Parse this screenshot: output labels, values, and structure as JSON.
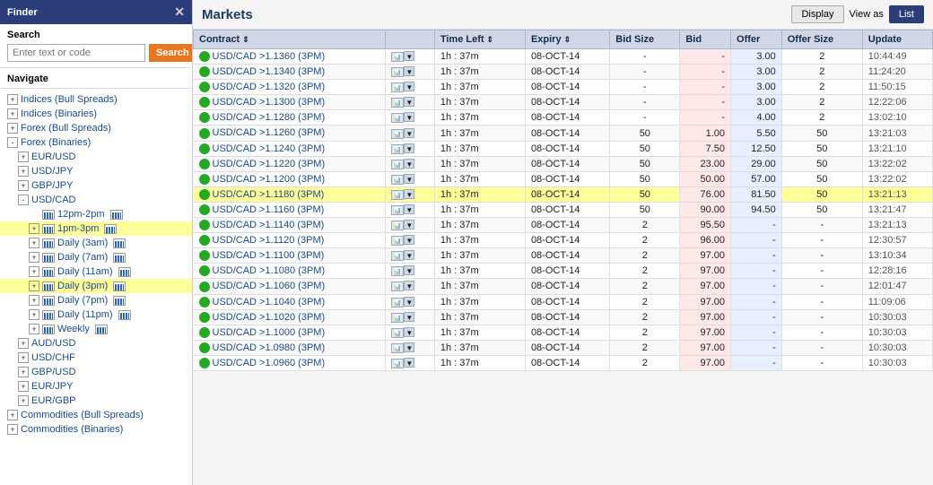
{
  "sidebar": {
    "title": "Finder",
    "close_label": "✕",
    "search": {
      "label": "Search",
      "placeholder": "Enter text or code",
      "button_label": "Search"
    },
    "navigate_label": "Navigate",
    "nav_items": [
      {
        "id": "indices-bull",
        "label": "Indices (Bull Spreads)",
        "indent": 0,
        "expander": "+",
        "highlighted": false
      },
      {
        "id": "indices-bin",
        "label": "Indices (Binaries)",
        "indent": 0,
        "expander": "+",
        "highlighted": false
      },
      {
        "id": "forex-bull",
        "label": "Forex (Bull Spreads)",
        "indent": 0,
        "expander": "+",
        "highlighted": false
      },
      {
        "id": "forex-bin",
        "label": "Forex (Binaries)",
        "indent": 0,
        "expander": "-",
        "highlighted": false
      },
      {
        "id": "eur-usd",
        "label": "EUR/USD",
        "indent": 1,
        "expander": "+",
        "highlighted": false
      },
      {
        "id": "usd-jpy",
        "label": "USD/JPY",
        "indent": 1,
        "expander": "+",
        "highlighted": false
      },
      {
        "id": "gbp-jpy",
        "label": "GBP/JPY",
        "indent": 1,
        "expander": "+",
        "highlighted": false
      },
      {
        "id": "usd-cad",
        "label": "USD/CAD",
        "indent": 1,
        "expander": "-",
        "highlighted": false
      },
      {
        "id": "12pm-2pm",
        "label": "12pm-2pm",
        "indent": 2,
        "expander": null,
        "highlighted": false,
        "has_chart": true
      },
      {
        "id": "1pm-3pm",
        "label": "1pm-3pm",
        "indent": 2,
        "expander": "+",
        "highlighted": true,
        "has_chart": true
      },
      {
        "id": "daily-3am",
        "label": "Daily (3am)",
        "indent": 2,
        "expander": "+",
        "highlighted": false,
        "has_chart": true
      },
      {
        "id": "daily-7am",
        "label": "Daily (7am)",
        "indent": 2,
        "expander": "+",
        "highlighted": false,
        "has_chart": true
      },
      {
        "id": "daily-11am",
        "label": "Daily (11am)",
        "indent": 2,
        "expander": "+",
        "highlighted": false,
        "has_chart": true
      },
      {
        "id": "daily-3pm",
        "label": "Daily (3pm)",
        "indent": 2,
        "expander": "+",
        "highlighted": true,
        "has_chart": true
      },
      {
        "id": "daily-7pm",
        "label": "Daily (7pm)",
        "indent": 2,
        "expander": "+",
        "highlighted": false,
        "has_chart": true
      },
      {
        "id": "daily-11pm",
        "label": "Daily (11pm)",
        "indent": 2,
        "expander": "+",
        "highlighted": false,
        "has_chart": true
      },
      {
        "id": "weekly",
        "label": "Weekly",
        "indent": 2,
        "expander": "+",
        "highlighted": false,
        "has_chart": true
      },
      {
        "id": "aud-usd",
        "label": "AUD/USD",
        "indent": 1,
        "expander": "+",
        "highlighted": false
      },
      {
        "id": "usd-chf",
        "label": "USD/CHF",
        "indent": 1,
        "expander": "+",
        "highlighted": false
      },
      {
        "id": "gbp-usd",
        "label": "GBP/USD",
        "indent": 1,
        "expander": "+",
        "highlighted": false
      },
      {
        "id": "eur-jpy",
        "label": "EUR/JPY",
        "indent": 1,
        "expander": "+",
        "highlighted": false
      },
      {
        "id": "eur-gbp",
        "label": "EUR/GBP",
        "indent": 1,
        "expander": "+",
        "highlighted": false
      },
      {
        "id": "commodities-bull",
        "label": "Commodities (Bull Spreads)",
        "indent": 0,
        "expander": "+",
        "highlighted": false
      },
      {
        "id": "commodities-bin",
        "label": "Commodities (Binaries)",
        "indent": 0,
        "expander": "+",
        "highlighted": false
      }
    ]
  },
  "main": {
    "title": "Markets",
    "display_label": "Display",
    "view_as_label": "View as",
    "list_label": "List",
    "columns": [
      {
        "id": "contract",
        "label": "Contract",
        "sortable": true
      },
      {
        "id": "icons",
        "label": "",
        "sortable": false
      },
      {
        "id": "timeleft",
        "label": "Time Left",
        "sortable": true
      },
      {
        "id": "expiry",
        "label": "Expiry",
        "sortable": true
      },
      {
        "id": "bidsize",
        "label": "Bid Size",
        "sortable": false
      },
      {
        "id": "bid",
        "label": "Bid",
        "sortable": false
      },
      {
        "id": "offer",
        "label": "Offer",
        "sortable": false
      },
      {
        "id": "offersize",
        "label": "Offer Size",
        "sortable": false
      },
      {
        "id": "update",
        "label": "Update",
        "sortable": false
      }
    ],
    "rows": [
      {
        "contract": "USD/CAD >1.1360 (3PM)",
        "timeleft": "1h : 37m",
        "expiry": "08-OCT-14",
        "bidsize": "-",
        "bid": "-",
        "offer": "3.00",
        "offersize": "2",
        "update": "10:44:49",
        "highlighted": false
      },
      {
        "contract": "USD/CAD >1.1340 (3PM)",
        "timeleft": "1h : 37m",
        "expiry": "08-OCT-14",
        "bidsize": "-",
        "bid": "-",
        "offer": "3.00",
        "offersize": "2",
        "update": "11:24:20",
        "highlighted": false
      },
      {
        "contract": "USD/CAD >1.1320 (3PM)",
        "timeleft": "1h : 37m",
        "expiry": "08-OCT-14",
        "bidsize": "-",
        "bid": "-",
        "offer": "3.00",
        "offersize": "2",
        "update": "11:50:15",
        "highlighted": false
      },
      {
        "contract": "USD/CAD >1.1300 (3PM)",
        "timeleft": "1h : 37m",
        "expiry": "08-OCT-14",
        "bidsize": "-",
        "bid": "-",
        "offer": "3.00",
        "offersize": "2",
        "update": "12:22:06",
        "highlighted": false
      },
      {
        "contract": "USD/CAD >1.1280 (3PM)",
        "timeleft": "1h : 37m",
        "expiry": "08-OCT-14",
        "bidsize": "-",
        "bid": "-",
        "offer": "4.00",
        "offersize": "2",
        "update": "13:02:10",
        "highlighted": false
      },
      {
        "contract": "USD/CAD >1.1260 (3PM)",
        "timeleft": "1h : 37m",
        "expiry": "08-OCT-14",
        "bidsize": "50",
        "bid": "1.00",
        "offer": "5.50",
        "offersize": "50",
        "update": "13:21:03",
        "highlighted": false
      },
      {
        "contract": "USD/CAD >1.1240 (3PM)",
        "timeleft": "1h : 37m",
        "expiry": "08-OCT-14",
        "bidsize": "50",
        "bid": "7.50",
        "offer": "12.50",
        "offersize": "50",
        "update": "13:21:10",
        "highlighted": false
      },
      {
        "contract": "USD/CAD >1.1220 (3PM)",
        "timeleft": "1h : 37m",
        "expiry": "08-OCT-14",
        "bidsize": "50",
        "bid": "23.00",
        "offer": "29.00",
        "offersize": "50",
        "update": "13:22:02",
        "highlighted": false
      },
      {
        "contract": "USD/CAD >1.1200 (3PM)",
        "timeleft": "1h : 37m",
        "expiry": "08-OCT-14",
        "bidsize": "50",
        "bid": "50.00",
        "offer": "57.00",
        "offersize": "50",
        "update": "13:22:02",
        "highlighted": false
      },
      {
        "contract": "USD/CAD >1.1180 (3PM)",
        "timeleft": "1h : 37m",
        "expiry": "08-OCT-14",
        "bidsize": "50",
        "bid": "76.00",
        "offer": "81.50",
        "offersize": "50",
        "update": "13:21:13",
        "highlighted": true
      },
      {
        "contract": "USD/CAD >1.1160 (3PM)",
        "timeleft": "1h : 37m",
        "expiry": "08-OCT-14",
        "bidsize": "50",
        "bid": "90.00",
        "offer": "94.50",
        "offersize": "50",
        "update": "13:21:47",
        "highlighted": false
      },
      {
        "contract": "USD/CAD >1.1140 (3PM)",
        "timeleft": "1h : 37m",
        "expiry": "08-OCT-14",
        "bidsize": "2",
        "bid": "95.50",
        "offer": "-",
        "offersize": "-",
        "update": "13:21:13",
        "highlighted": false
      },
      {
        "contract": "USD/CAD >1.1120 (3PM)",
        "timeleft": "1h : 37m",
        "expiry": "08-OCT-14",
        "bidsize": "2",
        "bid": "96.00",
        "offer": "-",
        "offersize": "-",
        "update": "12:30:57",
        "highlighted": false
      },
      {
        "contract": "USD/CAD >1.1100 (3PM)",
        "timeleft": "1h : 37m",
        "expiry": "08-OCT-14",
        "bidsize": "2",
        "bid": "97.00",
        "offer": "-",
        "offersize": "-",
        "update": "13:10:34",
        "highlighted": false
      },
      {
        "contract": "USD/CAD >1.1080 (3PM)",
        "timeleft": "1h : 37m",
        "expiry": "08-OCT-14",
        "bidsize": "2",
        "bid": "97.00",
        "offer": "-",
        "offersize": "-",
        "update": "12:28:16",
        "highlighted": false
      },
      {
        "contract": "USD/CAD >1.1060 (3PM)",
        "timeleft": "1h : 37m",
        "expiry": "08-OCT-14",
        "bidsize": "2",
        "bid": "97.00",
        "offer": "-",
        "offersize": "-",
        "update": "12:01:47",
        "highlighted": false
      },
      {
        "contract": "USD/CAD >1.1040 (3PM)",
        "timeleft": "1h : 37m",
        "expiry": "08-OCT-14",
        "bidsize": "2",
        "bid": "97.00",
        "offer": "-",
        "offersize": "-",
        "update": "11:09:06",
        "highlighted": false
      },
      {
        "contract": "USD/CAD >1.1020 (3PM)",
        "timeleft": "1h : 37m",
        "expiry": "08-OCT-14",
        "bidsize": "2",
        "bid": "97.00",
        "offer": "-",
        "offersize": "-",
        "update": "10:30:03",
        "highlighted": false
      },
      {
        "contract": "USD/CAD >1.1000 (3PM)",
        "timeleft": "1h : 37m",
        "expiry": "08-OCT-14",
        "bidsize": "2",
        "bid": "97.00",
        "offer": "-",
        "offersize": "-",
        "update": "10:30:03",
        "highlighted": false
      },
      {
        "contract": "USD/CAD >1.0980 (3PM)",
        "timeleft": "1h : 37m",
        "expiry": "08-OCT-14",
        "bidsize": "2",
        "bid": "97.00",
        "offer": "-",
        "offersize": "-",
        "update": "10:30:03",
        "highlighted": false
      },
      {
        "contract": "USD/CAD >1.0960 (3PM)",
        "timeleft": "1h : 37m",
        "expiry": "08-OCT-14",
        "bidsize": "2",
        "bid": "97.00",
        "offer": "-",
        "offersize": "-",
        "update": "10:30:03",
        "highlighted": false
      }
    ]
  }
}
